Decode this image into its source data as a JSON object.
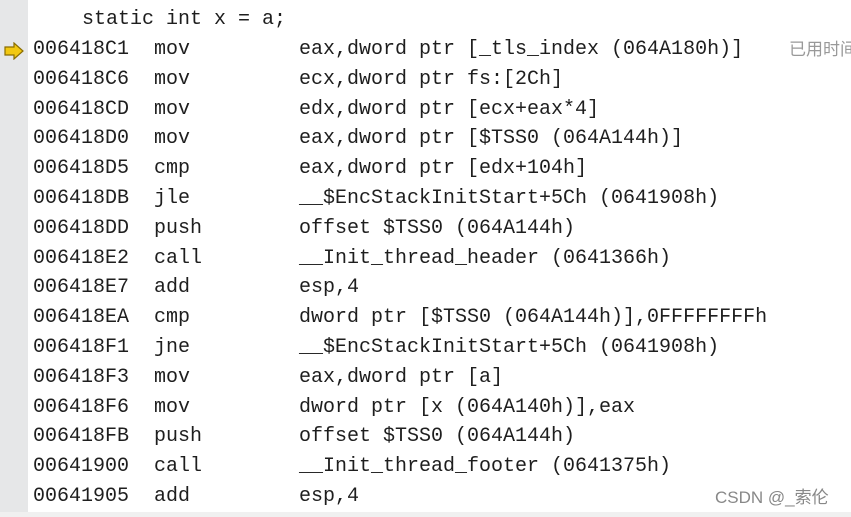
{
  "source_line": "static int x = a;",
  "hint": "已用时间",
  "watermark": "CSDN @_索伦",
  "current_marker": "arrow-icon",
  "accent": "#f2c811",
  "rows": [
    {
      "addr": "006418C1",
      "mn": "mov",
      "op": "eax,dword ptr [_tls_index (064A180h)]"
    },
    {
      "addr": "006418C6",
      "mn": "mov",
      "op": "ecx,dword ptr fs:[2Ch]"
    },
    {
      "addr": "006418CD",
      "mn": "mov",
      "op": "edx,dword ptr [ecx+eax*4]"
    },
    {
      "addr": "006418D0",
      "mn": "mov",
      "op": "eax,dword ptr [$TSS0 (064A144h)]"
    },
    {
      "addr": "006418D5",
      "mn": "cmp",
      "op": "eax,dword ptr [edx+104h]"
    },
    {
      "addr": "006418DB",
      "mn": "jle",
      "op": "__$EncStackInitStart+5Ch (0641908h)"
    },
    {
      "addr": "006418DD",
      "mn": "push",
      "op": "offset $TSS0 (064A144h)"
    },
    {
      "addr": "006418E2",
      "mn": "call",
      "op": "__Init_thread_header (0641366h)"
    },
    {
      "addr": "006418E7",
      "mn": "add",
      "op": "esp,4"
    },
    {
      "addr": "006418EA",
      "mn": "cmp",
      "op": "dword ptr [$TSS0 (064A144h)],0FFFFFFFFh"
    },
    {
      "addr": "006418F1",
      "mn": "jne",
      "op": "__$EncStackInitStart+5Ch (0641908h)"
    },
    {
      "addr": "006418F3",
      "mn": "mov",
      "op": "eax,dword ptr [a]"
    },
    {
      "addr": "006418F6",
      "mn": "mov",
      "op": "dword ptr [x (064A140h)],eax"
    },
    {
      "addr": "006418FB",
      "mn": "push",
      "op": "offset $TSS0 (064A144h)"
    },
    {
      "addr": "00641900",
      "mn": "call",
      "op": "__Init_thread_footer (0641375h)"
    },
    {
      "addr": "00641905",
      "mn": "add",
      "op": "esp,4"
    }
  ]
}
